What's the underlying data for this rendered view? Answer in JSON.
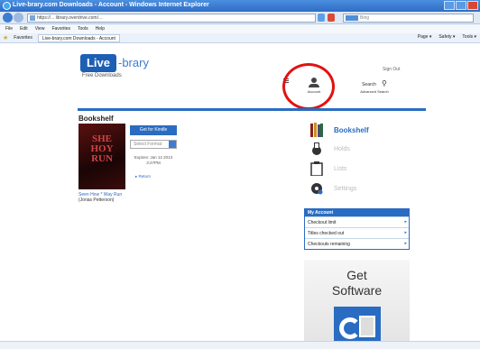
{
  "window": {
    "title": "Live-brary.com Downloads - Account - Windows Internet Explorer"
  },
  "browser": {
    "url": "https://... library.overdrive.com/...",
    "search_placeholder": "Bing",
    "menu": [
      "File",
      "Edit",
      "View",
      "Favorites",
      "Tools",
      "Help"
    ],
    "favorites_label": "Favorites",
    "tab_title": "Live-brary.com Downloads - Account",
    "tools": [
      "Page ▾",
      "Safety ▾",
      "Tools ▾"
    ]
  },
  "site": {
    "logo_main": "Live",
    "logo_rest": "-brary",
    "logo_sub": "Free Downloads",
    "sign_out": "Sign Out",
    "header_icons": {
      "account": "Account",
      "advanced_search": "Advanced Search",
      "search": "Search"
    }
  },
  "bookshelf": {
    "title": "Bookshelf",
    "book_cover_text": "SHE HOY RUN",
    "book_title": "Seen How * Way Run",
    "book_author": "(Jonas Petterson)",
    "kindle_button": "Get for Kindle",
    "select_placeholder": "Select Format",
    "expires": "Expires: Jan 12 2013 3:27PM",
    "return_link": "▸ Return"
  },
  "sidebar": {
    "items": [
      "Bookshelf",
      "Holds",
      "Lists",
      "Settings"
    ]
  },
  "my_account": {
    "title": "My Account",
    "rows": [
      "Checkout limit",
      "Titles checked out",
      "Checkouts remaining"
    ]
  },
  "promo": {
    "line1": "Get",
    "line2": "Software"
  },
  "colors": {
    "brand_blue": "#2a6cc2",
    "highlight_red": "#e21212"
  }
}
